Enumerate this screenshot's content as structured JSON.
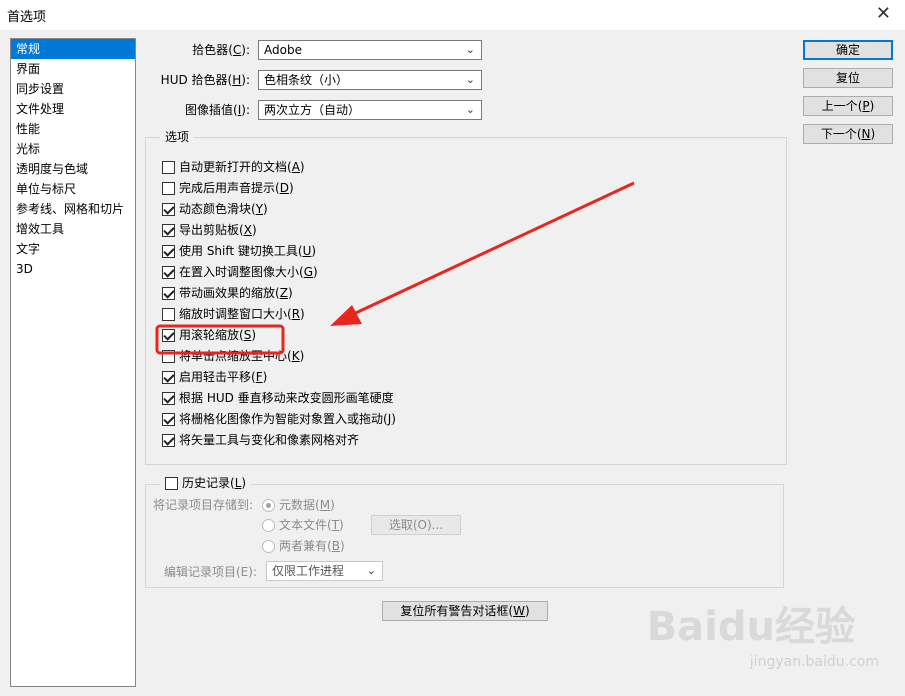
{
  "window": {
    "title": "首选项",
    "close_glyph": "✕"
  },
  "sidebar": {
    "items": [
      {
        "label": "常规",
        "selected": true
      },
      {
        "label": "界面"
      },
      {
        "label": "同步设置"
      },
      {
        "label": "文件处理"
      },
      {
        "label": "性能"
      },
      {
        "label": "光标"
      },
      {
        "label": "透明度与色域"
      },
      {
        "label": "单位与标尺"
      },
      {
        "label": "参考线、网格和切片"
      },
      {
        "label": "增效工具"
      },
      {
        "label": "文字"
      },
      {
        "label": "3D"
      }
    ]
  },
  "fields": {
    "picker": {
      "label": "拾色器",
      "key": "C",
      "value": "Adobe"
    },
    "hud_picker": {
      "label": "HUD 拾色器",
      "key": "H",
      "value": "色相条纹（小）"
    },
    "interp": {
      "label": "图像插值",
      "key": "I",
      "value": "两次立方（自动）"
    }
  },
  "options": {
    "title": "选项",
    "items": [
      {
        "label": "自动更新打开的文档",
        "key": "A",
        "checked": false
      },
      {
        "label": "完成后用声音提示",
        "key": "D",
        "checked": false
      },
      {
        "label": "动态颜色滑块",
        "key": "Y",
        "checked": true
      },
      {
        "label": "导出剪贴板",
        "key": "X",
        "checked": true
      },
      {
        "label": "使用 Shift 键切换工具",
        "key": "U",
        "checked": true
      },
      {
        "label": "在置入时调整图像大小",
        "key": "G",
        "checked": true
      },
      {
        "label": "带动画效果的缩放",
        "key": "Z",
        "checked": true
      },
      {
        "label": "缩放时调整窗口大小",
        "key": "R",
        "checked": false
      },
      {
        "label": "用滚轮缩放",
        "key": "S",
        "checked": true
      },
      {
        "label": "将单击点缩放至中心",
        "key": "K",
        "checked": false
      },
      {
        "label": "启用轻击平移",
        "key": "F",
        "checked": true
      },
      {
        "label": "根据 HUD 垂直移动来改变圆形画笔硬度",
        "key": "",
        "checked": true
      },
      {
        "label": "将栅格化图像作为智能对象置入或拖动",
        "key": "J",
        "checked": true
      },
      {
        "label": "将矢量工具与变化和像素网格对齐",
        "key": "",
        "checked": true
      }
    ]
  },
  "history": {
    "title": "历史记录",
    "key": "L",
    "checked": false,
    "save_to_label": "将记录项目存储到:",
    "radios": [
      {
        "label": "元数据",
        "key": "M",
        "selected": true
      },
      {
        "label": "文本文件",
        "key": "T",
        "selected": false
      },
      {
        "label": "两者兼有",
        "key": "B",
        "selected": false
      }
    ],
    "choose_button": "选取(O)...",
    "edit_log_label": "编辑记录项目(E):",
    "edit_log_value": "仅限工作进程"
  },
  "reset_warnings_button": {
    "label": "复位所有警告对话框",
    "key": "W"
  },
  "buttons": {
    "ok": "确定",
    "reset": "复位",
    "prev": {
      "label": "上一个",
      "key": "P"
    },
    "next": {
      "label": "下一个",
      "key": "N"
    }
  },
  "annotation": {
    "color": "#e8261f"
  },
  "watermark": {
    "logo": "Baidu经验",
    "url": "jingyan.baidu.com"
  }
}
